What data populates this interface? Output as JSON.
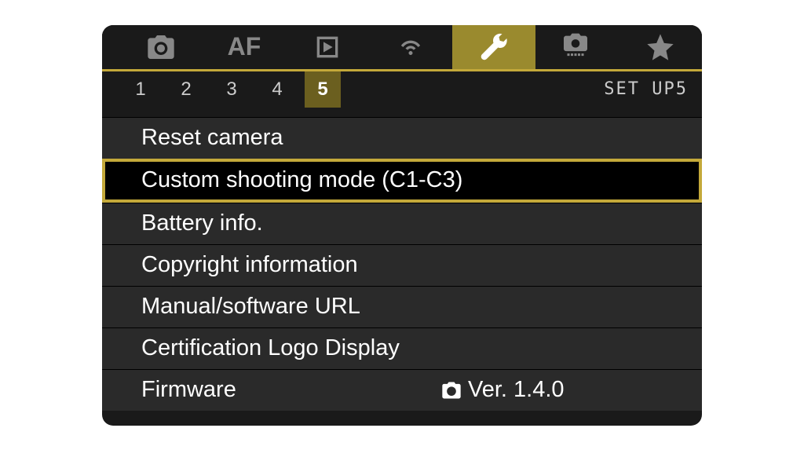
{
  "tabs": {
    "af_label": "AF",
    "items": [
      "camera",
      "af",
      "playback",
      "wireless",
      "setup",
      "custom",
      "favorite"
    ],
    "active_index": 4
  },
  "pages": {
    "numbers": [
      "1",
      "2",
      "3",
      "4",
      "5"
    ],
    "active_index": 4,
    "setup_label": "SET UP5"
  },
  "menu": {
    "items": [
      {
        "label": "Reset camera"
      },
      {
        "label": "Custom shooting mode (C1-C3)",
        "selected": true
      },
      {
        "label": "Battery info."
      },
      {
        "label": "Copyright information"
      },
      {
        "label": "Manual/software URL"
      },
      {
        "label": "Certification Logo Display"
      },
      {
        "label": "Firmware",
        "value": "Ver. 1.4.0"
      }
    ]
  },
  "colors": {
    "accent": "#c4a93a",
    "accent_dark": "#9a8a2e",
    "page_active": "#6b5f1f",
    "bg": "#1a1a1a",
    "item_bg": "#2a2a2a"
  }
}
